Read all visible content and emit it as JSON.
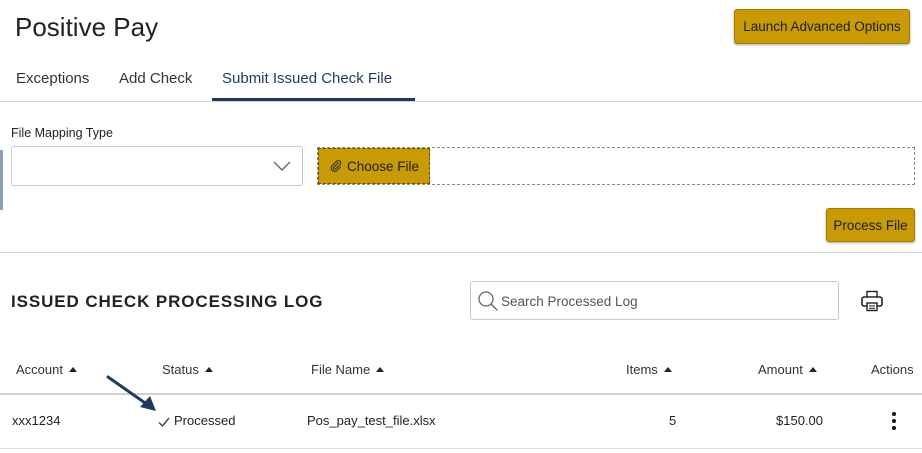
{
  "page": {
    "title": "Positive Pay"
  },
  "header": {
    "launch_label": "Launch Advanced Options"
  },
  "tabs": [
    {
      "label": "Exceptions"
    },
    {
      "label": "Add Check"
    },
    {
      "label": "Submit Issued Check File",
      "active": true
    }
  ],
  "form": {
    "mapping_label": "File Mapping Type",
    "mapping_value": "",
    "choose_file_label": "Choose File",
    "process_label": "Process File"
  },
  "log": {
    "title": "ISSUED CHECK PROCESSING LOG",
    "search_placeholder": "Search Processed Log",
    "columns": {
      "account": "Account",
      "status": "Status",
      "file_name": "File Name",
      "items": "Items",
      "amount": "Amount",
      "actions": "Actions"
    },
    "rows": [
      {
        "account": "xxx1234",
        "status": "Processed",
        "file_name": "Pos_pay_test_file.xlsx",
        "items": "5",
        "amount": "$150.00"
      }
    ]
  },
  "colors": {
    "accent": "#c89a05",
    "nav_active": "#1d3a5f",
    "arrow": "#1d3a5f"
  },
  "icons": [
    "chevron-down-icon",
    "paperclip-icon",
    "search-icon",
    "printer-icon",
    "checkmark-icon",
    "kebab-menu-icon",
    "pointer-arrow"
  ]
}
